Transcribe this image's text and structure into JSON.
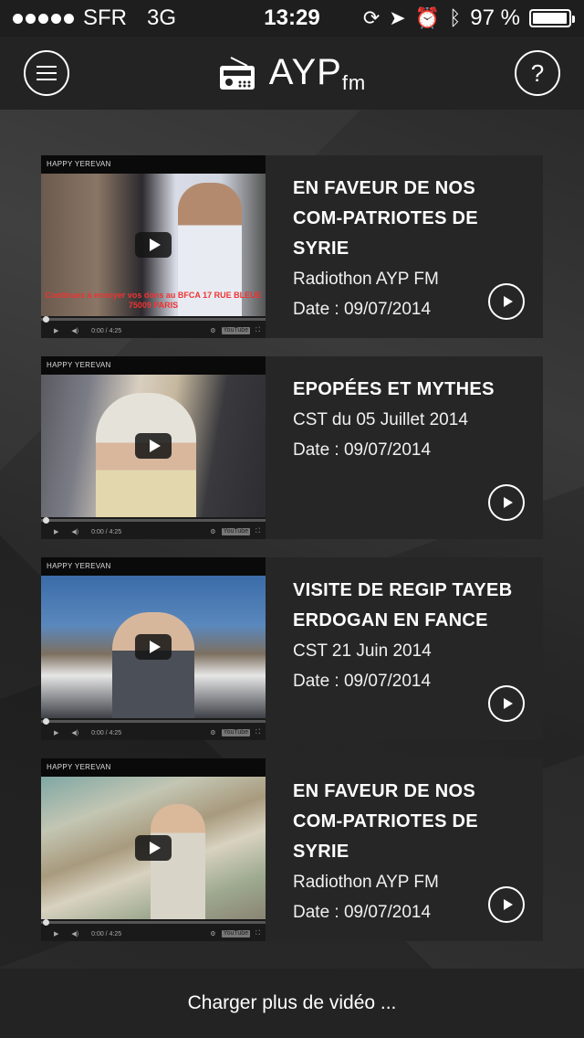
{
  "status_bar": {
    "carrier": "SFR",
    "network": "3G",
    "time": "13:29",
    "battery": "97 %",
    "battery_level": 0.97,
    "icons": [
      "lock-rotation-icon",
      "location-arrow-icon",
      "alarm-icon",
      "bluetooth-icon"
    ]
  },
  "header": {
    "logo_text": "AYP",
    "logo_sub": "fm",
    "menu_icon": "hamburger-menu-icon",
    "help_icon": "help-question-icon",
    "help_glyph": "?"
  },
  "videos": [
    {
      "channel": "HAPPY YEREVAN",
      "caption": "Continuez à envoyer vos dons au BFCA 17 RUE BLEUE 75009 PARIS",
      "time": "0:00 / 4:25",
      "title": "EN FAVEUR DE NOS COM-PATRIOTES DE SYRIE",
      "subtitle": "Radiothon AYP FM",
      "date": "Date : 09/07/2014"
    },
    {
      "channel": "HAPPY YEREVAN",
      "time": "0:00 / 4:25",
      "title": "EPOPÉES ET MYTHES",
      "subtitle": "CST du 05 Juillet 2014",
      "date": "Date : 09/07/2014"
    },
    {
      "channel": "HAPPY YEREVAN",
      "time": "0:00 / 4:25",
      "title": "VISITE DE REGIP TAYEB ERDOGAN EN FANCE",
      "subtitle": "CST 21 Juin 2014",
      "date": "Date : 09/07/2014"
    },
    {
      "channel": "HAPPY YEREVAN",
      "time": "0:00 / 4:25",
      "title": "EN FAVEUR DE NOS COM-PATRIOTES DE SYRIE",
      "subtitle": "Radiothon AYP FM",
      "date": "Date : 09/07/2014"
    }
  ],
  "video_badge": "YouTube",
  "footer": {
    "load_more": "Charger plus de vidéo ..."
  }
}
